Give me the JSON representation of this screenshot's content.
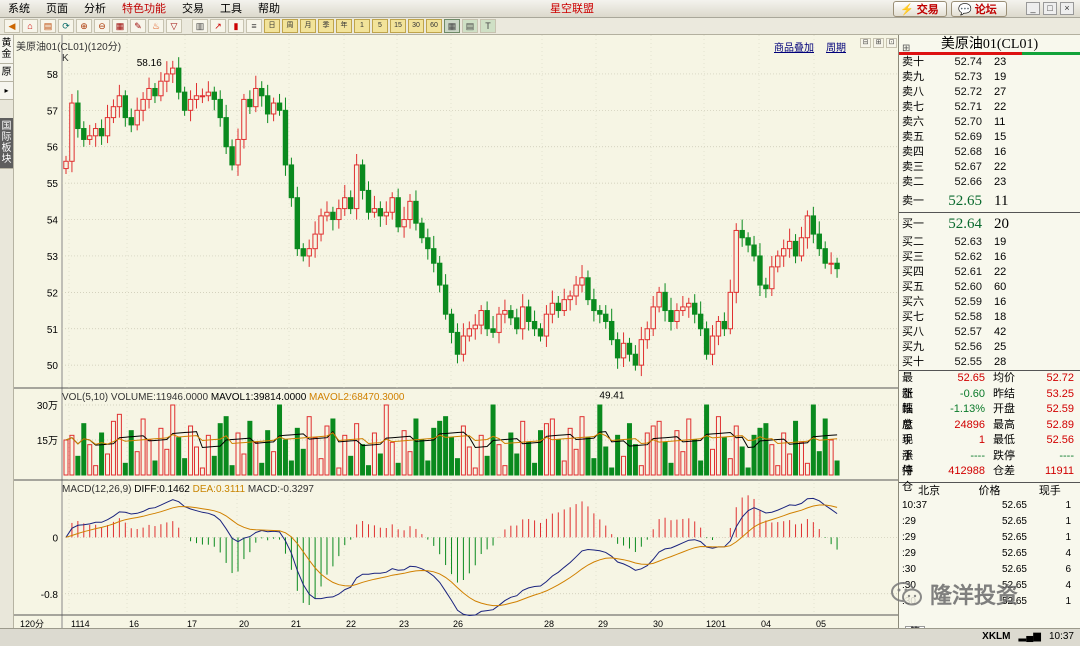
{
  "menu": [
    "系统",
    "页面",
    "分析",
    "特色功能",
    "交易",
    "工具",
    "帮助"
  ],
  "app_title": "星空联盟",
  "top_buttons": {
    "trade": "交易",
    "forum": "论坛"
  },
  "toolbar_nums": [
    "1",
    "5",
    "15",
    "30",
    "60"
  ],
  "sidetabs": [
    "黄金",
    "原",
    "国际板块"
  ],
  "chart_header": {
    "title": "美原油01(CL01)(120分)",
    "overlay_link": "商品叠加",
    "period_link": "周期",
    "k_label": "K"
  },
  "volume_label": {
    "name": "VOL(5,10)",
    "vol": "VOLUME:11946.0000",
    "ma1": "MAVOL1:39814.0000",
    "ma2": "MAVOL2:68470.3000"
  },
  "macd_label": {
    "name": "MACD(12,26,9)",
    "diff": "DIFF:0.1462",
    "dea": "DEA:0.3111",
    "macd": "MACD:-0.3297"
  },
  "price_axis": [
    "58",
    "57",
    "56",
    "55",
    "54",
    "53",
    "52",
    "51",
    "50"
  ],
  "vol_axis": [
    "30万",
    "15万"
  ],
  "macd_axis": [
    "0",
    "-0.8"
  ],
  "x_axis": [
    "120分",
    "1114",
    "16",
    "17",
    "20",
    "21",
    "22",
    "23",
    "26",
    "28",
    "29",
    "30",
    "1201",
    "04",
    "05"
  ],
  "annotations": {
    "high": "58.16",
    "low": "49.41"
  },
  "chart_data": {
    "type": "candlestick",
    "ylim": [
      49.4,
      58.3
    ],
    "close": [
      55.6,
      57.2,
      56.5,
      56.2,
      56.3,
      56.5,
      56.3,
      56.8,
      57.1,
      57.4,
      56.8,
      56.6,
      57.0,
      57.3,
      57.6,
      57.4,
      57.8,
      58.0,
      58.16,
      57.5,
      57.0,
      57.3,
      57.4,
      57.4,
      57.5,
      57.3,
      56.8,
      56.0,
      55.5,
      56.2,
      57.3,
      57.1,
      57.6,
      57.4,
      56.9,
      57.2,
      57.0,
      55.5,
      54.6,
      53.2,
      53.0,
      53.2,
      53.6,
      54.1,
      54.2,
      54.0,
      54.3,
      54.6,
      54.3,
      55.5,
      54.8,
      54.2,
      54.3,
      54.1,
      54.2,
      54.6,
      53.8,
      54.0,
      54.5,
      53.9,
      53.5,
      53.2,
      52.8,
      52.2,
      51.4,
      50.9,
      50.3,
      50.8,
      51.0,
      51.1,
      51.5,
      51.0,
      50.9,
      51.4,
      51.5,
      51.3,
      51.0,
      51.6,
      51.2,
      51.0,
      50.8,
      51.4,
      51.7,
      51.5,
      51.8,
      51.9,
      52.2,
      52.4,
      51.8,
      51.5,
      51.4,
      51.2,
      50.7,
      50.2,
      50.6,
      50.3,
      50.0,
      50.7,
      51.0,
      51.6,
      52.0,
      51.5,
      51.2,
      51.5,
      51.6,
      51.7,
      51.4,
      51.0,
      50.3,
      50.8,
      51.2,
      51.0,
      52.0,
      53.7,
      53.5,
      53.3,
      53.0,
      52.2,
      52.1,
      52.7,
      53.0,
      53.2,
      53.4,
      53.0,
      53.5,
      54.1,
      53.6,
      53.2,
      52.8,
      52.8,
      52.65
    ],
    "volume_max_wan": 30,
    "macd_range": [
      -1.2,
      0.6
    ]
  },
  "quote": {
    "title": "美原油01(CL01)",
    "asks": [
      [
        "卖十",
        "52.74",
        "23"
      ],
      [
        "卖九",
        "52.73",
        "19"
      ],
      [
        "卖八",
        "52.72",
        "27"
      ],
      [
        "卖七",
        "52.71",
        "22"
      ],
      [
        "卖六",
        "52.70",
        "11"
      ],
      [
        "卖五",
        "52.69",
        "15"
      ],
      [
        "卖四",
        "52.68",
        "16"
      ],
      [
        "卖三",
        "52.67",
        "22"
      ],
      [
        "卖二",
        "52.66",
        "23"
      ],
      [
        "卖一",
        "52.65",
        "11"
      ]
    ],
    "bids": [
      [
        "买一",
        "52.64",
        "20"
      ],
      [
        "买二",
        "52.63",
        "19"
      ],
      [
        "买三",
        "52.62",
        "16"
      ],
      [
        "买四",
        "52.61",
        "22"
      ],
      [
        "买五",
        "52.60",
        "60"
      ],
      [
        "买六",
        "52.59",
        "16"
      ],
      [
        "买七",
        "52.58",
        "18"
      ],
      [
        "买八",
        "52.57",
        "42"
      ],
      [
        "买九",
        "52.56",
        "25"
      ],
      [
        "买十",
        "52.55",
        "28"
      ]
    ],
    "stats": [
      [
        "最新",
        "52.65",
        "均价",
        "52.72"
      ],
      [
        "涨跌",
        "-0.60",
        "昨结",
        "53.25"
      ],
      [
        "幅度",
        "-1.13%",
        "开盘",
        "52.59"
      ],
      [
        "总手",
        "24896",
        "最高",
        "52.89"
      ],
      [
        "现手",
        "1",
        "最低",
        "52.56"
      ],
      [
        "涨停",
        "----",
        "跌停",
        "----"
      ],
      [
        "持仓",
        "412988",
        "仓差",
        "11911"
      ]
    ],
    "tick_head": [
      "北京",
      "价格",
      "现手"
    ],
    "ticks": [
      [
        "10:37",
        "52.65",
        "1"
      ],
      [
        ":29",
        "52.65",
        "1"
      ],
      [
        ":29",
        "52.65",
        "1"
      ],
      [
        ":29",
        "52.65",
        "4"
      ],
      [
        ":30",
        "52.65",
        "6"
      ],
      [
        ":30",
        "52.65",
        "4"
      ],
      [
        ":30",
        "52.65",
        "1"
      ]
    ],
    "footer": "笔"
  },
  "status": {
    "brand": "XKLM",
    "time": "10:37"
  },
  "watermark": "隆洋投资"
}
